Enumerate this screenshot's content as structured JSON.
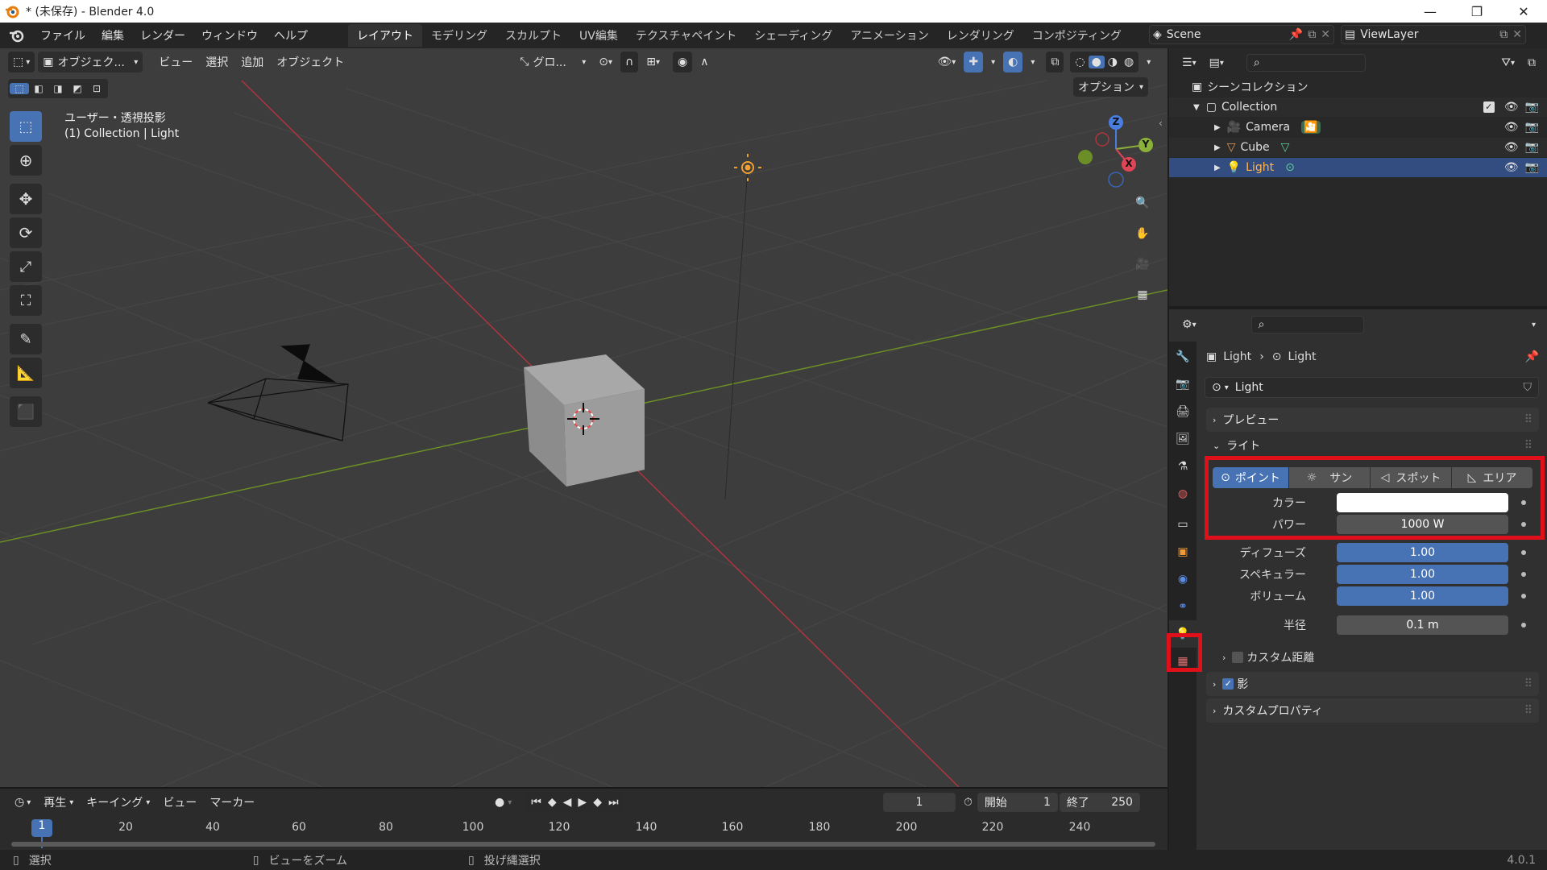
{
  "window": {
    "title": "* (未保存) - Blender 4.0",
    "controls": [
      "—",
      "❐",
      "✕"
    ]
  },
  "menubar": {
    "menus": [
      "ファイル",
      "編集",
      "レンダー",
      "ウィンドウ",
      "ヘルプ"
    ],
    "workspaces": [
      "レイアウト",
      "モデリング",
      "スカルプト",
      "UV編集",
      "テクスチャペイント",
      "シェーディング",
      "アニメーション",
      "レンダリング",
      "コンポジティング"
    ],
    "active_workspace": "レイアウト",
    "scene": "Scene",
    "view_layer": "ViewLayer"
  },
  "viewport": {
    "header": {
      "mode": "オブジェク...",
      "menus": [
        "ビュー",
        "選択",
        "追加",
        "オブジェクト"
      ],
      "orientation": "グロ..."
    },
    "options_label": "オプション",
    "overlay_title": "ユーザー・透視投影",
    "overlay_subtitle": "(1) Collection | Light",
    "gizmo": {
      "z": "Z",
      "y": "Y",
      "x": "X"
    }
  },
  "timeline": {
    "menus": [
      "再生",
      "キーイング",
      "ビュー",
      "マーカー"
    ],
    "current_frame": "1",
    "start_label": "開始",
    "start": "1",
    "end_label": "終了",
    "end": "250",
    "ticks": [
      "20",
      "40",
      "60",
      "80",
      "100",
      "120",
      "140",
      "160",
      "180",
      "200",
      "220",
      "240"
    ],
    "playhead": "1"
  },
  "statusbar": {
    "items": [
      "選択",
      "ビューをズーム",
      "投げ縄選択"
    ],
    "version": "4.0.1"
  },
  "outliner": {
    "scene_collection": "シーンコレクション",
    "collection": "Collection",
    "objects": [
      {
        "name": "Camera",
        "selected": false
      },
      {
        "name": "Cube",
        "selected": false
      },
      {
        "name": "Light",
        "selected": true
      }
    ]
  },
  "properties": {
    "breadcrumb": [
      "Light",
      "Light"
    ],
    "datablock": "Light",
    "panels": {
      "preview": "プレビュー",
      "light": "ライト",
      "shadow": "影",
      "custom_props": "カスタムプロパティ",
      "custom_distance": "カスタム距離"
    },
    "light_types": [
      "ポイント",
      "サン",
      "スポット",
      "エリア"
    ],
    "active_light_type": "ポイント",
    "fields": {
      "color_label": "カラー",
      "color_value": "#ffffff",
      "power_label": "パワー",
      "power_value": "1000 W",
      "diffuse_label": "ディフューズ",
      "diffuse_value": "1.00",
      "specular_label": "スペキュラー",
      "specular_value": "1.00",
      "volume_label": "ボリューム",
      "volume_value": "1.00",
      "radius_label": "半径",
      "radius_value": "0.1 m"
    },
    "shadow_enabled": true,
    "custom_distance_enabled": false
  },
  "colors": {
    "accent": "#4772b3",
    "highlight": "#e0101a",
    "selected_row": "#334d80",
    "viewport_bg": "#3d3d3d"
  }
}
